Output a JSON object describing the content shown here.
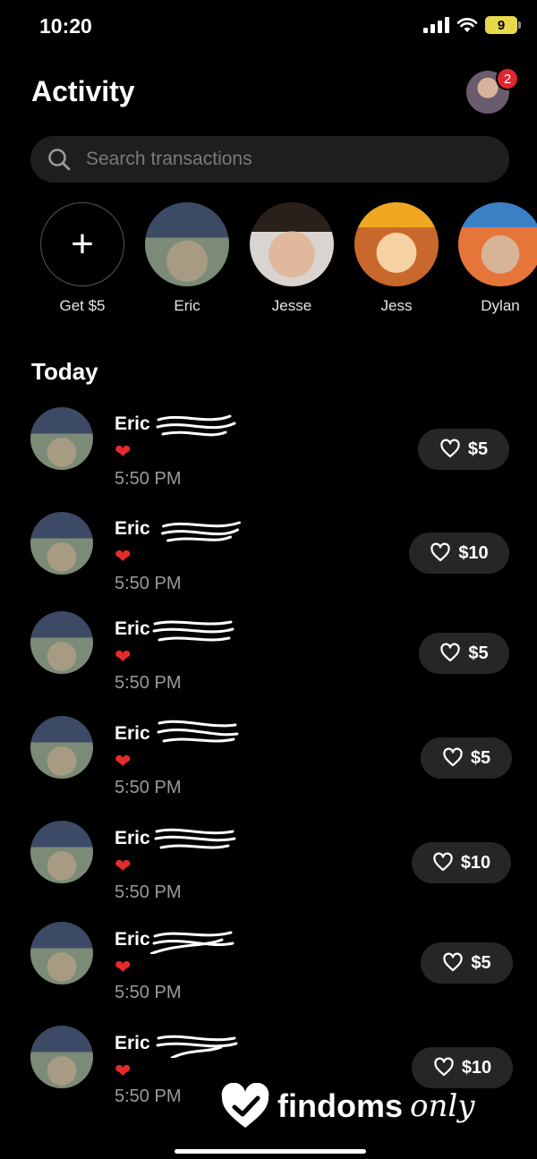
{
  "status_bar": {
    "time": "10:20",
    "battery": "9"
  },
  "header": {
    "title": "Activity",
    "notification_count": "2"
  },
  "search": {
    "placeholder": "Search transactions"
  },
  "contacts": [
    {
      "name": "Get $5"
    },
    {
      "name": "Eric"
    },
    {
      "name": "Jesse"
    },
    {
      "name": "Jess"
    },
    {
      "name": "Dylan"
    }
  ],
  "section_title": "Today",
  "transactions": [
    {
      "name": "Eric",
      "emoji": "❤",
      "time": "5:50 PM",
      "amount": "$5"
    },
    {
      "name": "Eric",
      "emoji": "❤",
      "time": "5:50 PM",
      "amount": "$10"
    },
    {
      "name": "Eric",
      "emoji": "❤",
      "time": "5:50 PM",
      "amount": "$5"
    },
    {
      "name": "Eric",
      "emoji": "❤",
      "time": "5:50 PM",
      "amount": "$5"
    },
    {
      "name": "Eric",
      "emoji": "❤",
      "time": "5:50 PM",
      "amount": "$10"
    },
    {
      "name": "Eric",
      "emoji": "❤",
      "time": "5:50 PM",
      "amount": "$5"
    },
    {
      "name": "Eric",
      "emoji": "❤",
      "time": "5:50 PM",
      "amount": "$10"
    }
  ],
  "watermark": {
    "text": "findoms",
    "suffix": "only"
  },
  "icons": {
    "search": "search-icon",
    "heart": "heart-outline-icon",
    "add": "plus-icon"
  }
}
